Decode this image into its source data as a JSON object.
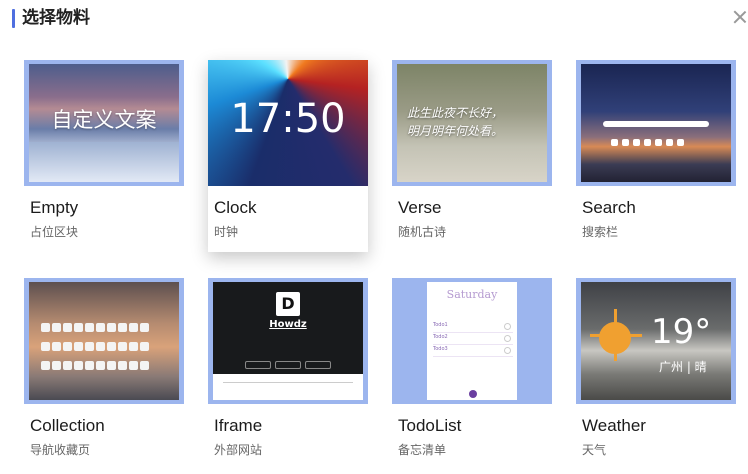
{
  "dialog": {
    "title": "选择物料"
  },
  "cards": [
    {
      "name": "Empty",
      "desc": "占位区块",
      "thumb_text": "自定义文案"
    },
    {
      "name": "Clock",
      "desc": "时钟",
      "thumb_text": "17:50"
    },
    {
      "name": "Verse",
      "desc": "随机古诗",
      "thumb_lines": [
        "此生此夜不长好，",
        "明月明年何处看。"
      ]
    },
    {
      "name": "Search",
      "desc": "搜索栏"
    },
    {
      "name": "Collection",
      "desc": "导航收藏页"
    },
    {
      "name": "Iframe",
      "desc": "外部网站",
      "thumb_title": "Howdz"
    },
    {
      "name": "TodoList",
      "desc": "备忘清单",
      "thumb_day": "Saturday",
      "thumb_items": [
        "Todo1",
        "Todo2",
        "Todo3"
      ]
    },
    {
      "name": "Weather",
      "desc": "天气",
      "thumb_temp": "19°",
      "thumb_city": "广州 | 晴"
    }
  ],
  "colors": {
    "accent": "#4f6fe0",
    "thumb_border": "#9cb5ee"
  },
  "icons": {
    "close": "close-icon"
  }
}
